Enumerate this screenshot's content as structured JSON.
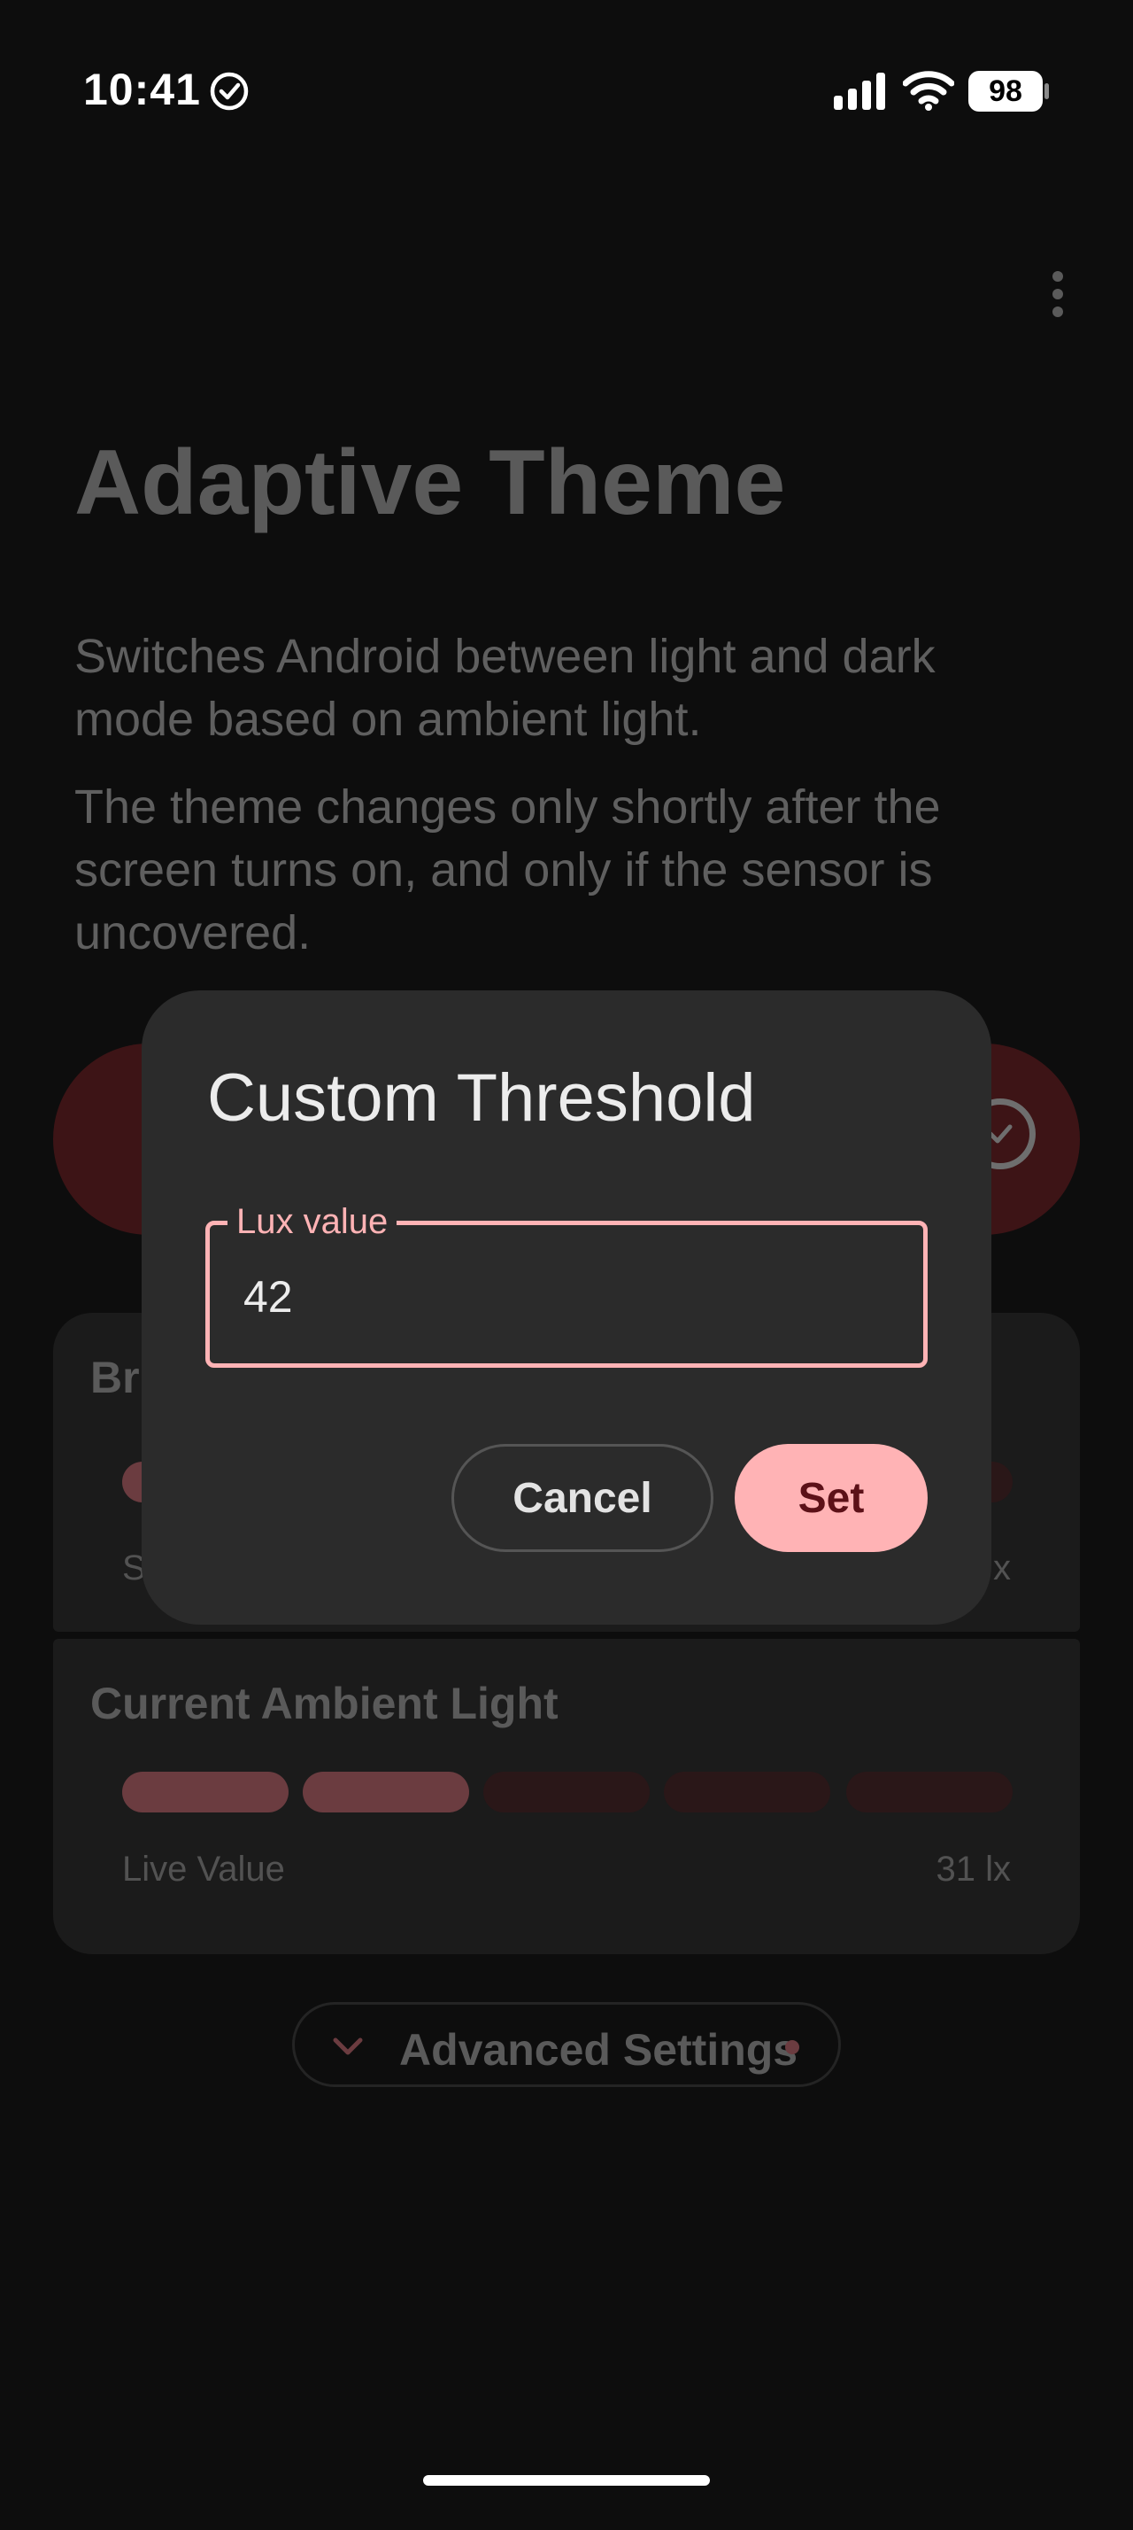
{
  "status_bar": {
    "time": "10:41",
    "battery": "98",
    "icons": [
      "check-circle-icon",
      "signal-icon",
      "wifi-icon",
      "battery-icon"
    ]
  },
  "page": {
    "title": "Adaptive Theme",
    "description_1": "Switches Android between light and dark mode based on ambient light.",
    "description_2": "The theme changes only shortly after the screen turns on, and only if the sensor is uncovered."
  },
  "brightness_card": {
    "title": "Br",
    "footer_left": "S",
    "footer_right": "x"
  },
  "ambient_card": {
    "title": "Current Ambient Light",
    "footer_left": "Live Value",
    "footer_right": "31 lx",
    "segments_active": 2,
    "segments_total": 5
  },
  "advanced": {
    "label": "Advanced Settings"
  },
  "dialog": {
    "title": "Custom Threshold",
    "field_label": "Lux value",
    "field_value": "42",
    "cancel_label": "Cancel",
    "set_label": "Set"
  },
  "colors": {
    "accent": "#ffb3b5",
    "on_accent": "#5c1118",
    "background": "#0d0d0d",
    "dialog_surface": "#2b2b2b"
  }
}
